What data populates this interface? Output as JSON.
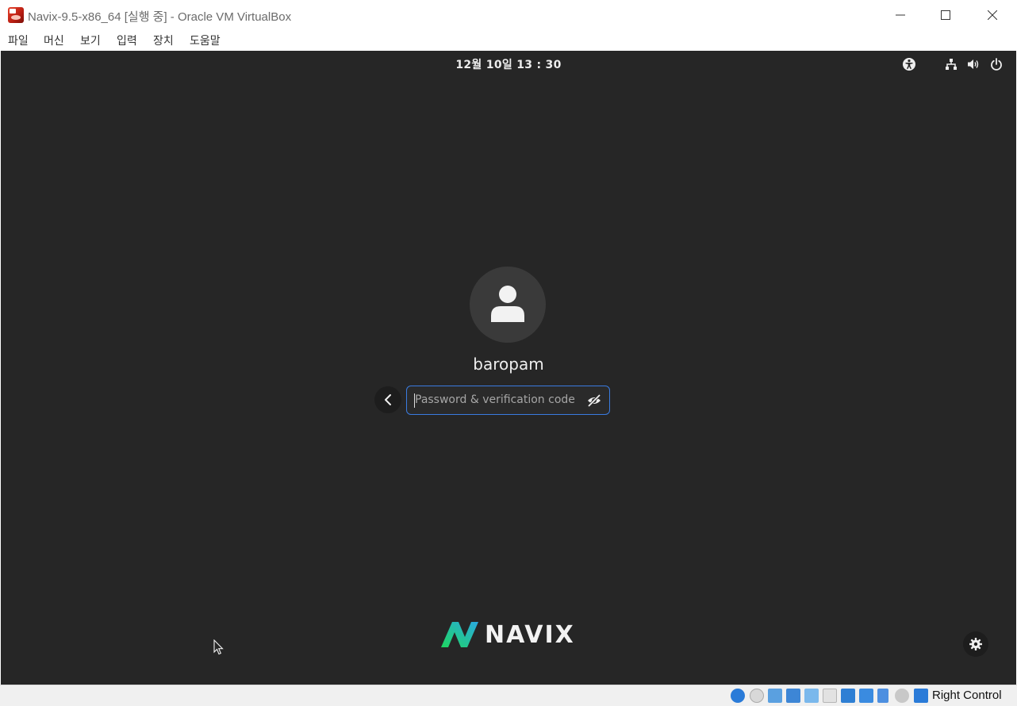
{
  "window": {
    "title": "Navix-9.5-x86_64 [실행 중] - Oracle VM VirtualBox"
  },
  "menu": {
    "items": [
      "파일",
      "머신",
      "보기",
      "입력",
      "장치",
      "도움말"
    ]
  },
  "topbar": {
    "clock": "12월 10일  13 : 30"
  },
  "login": {
    "username": "baropam",
    "password_placeholder": "Password & verification code"
  },
  "branding": {
    "logo_text": "NAVIX",
    "accent_green": "#1ed760",
    "accent_blue": "#2aa9e0"
  },
  "statusbar": {
    "host_key": "Right Control"
  },
  "colors": {
    "screen_bg": "#262626",
    "focus_border": "#3a7be0"
  }
}
